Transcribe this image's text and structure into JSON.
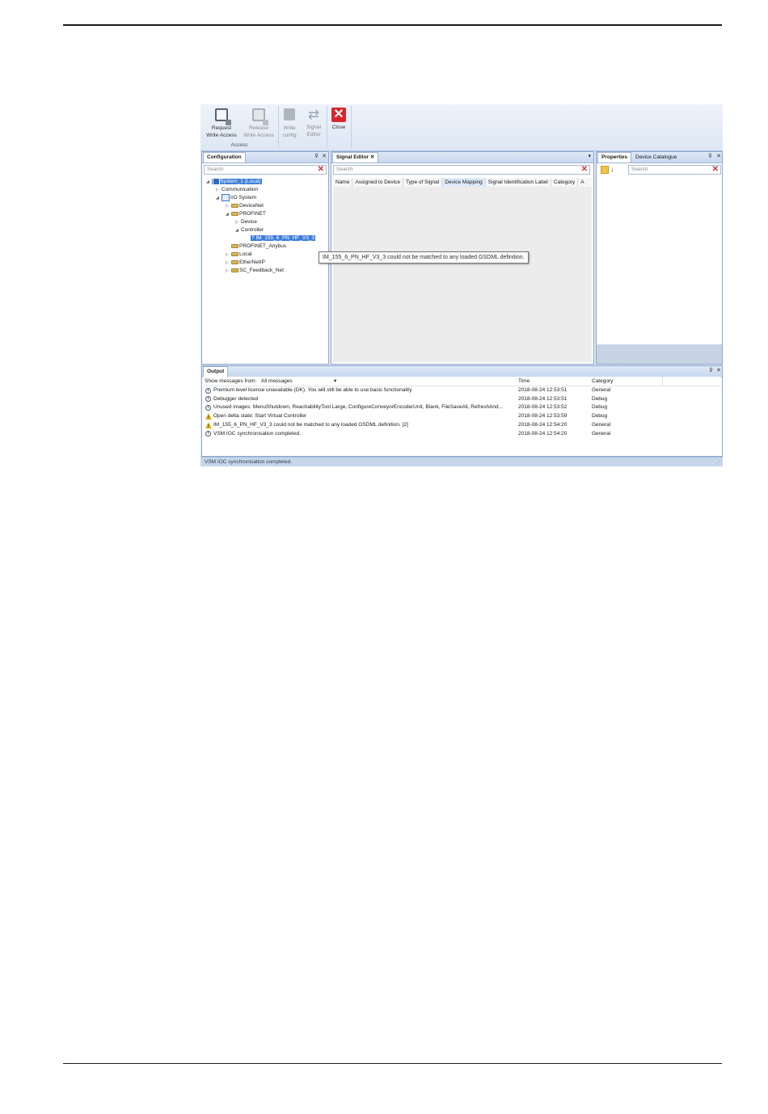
{
  "ribbon": {
    "buttons": [
      {
        "label_line1": "Request",
        "label_line2": "Write Access",
        "icon": "device-lock-icon",
        "enabled": true
      },
      {
        "label_line1": "Release",
        "label_line2": "Write Access",
        "icon": "device-unlock-icon",
        "enabled": false
      },
      {
        "label_line1": "Write",
        "label_line2": "config",
        "icon": "write-config-icon",
        "enabled": false
      },
      {
        "label_line1": "Signal",
        "label_line2": "Editor",
        "icon": "swap-arrows-icon",
        "enabled": false
      },
      {
        "label_line1": "Close",
        "label_line2": "",
        "icon": "close-icon",
        "enabled": true
      }
    ],
    "group_label": "Access"
  },
  "configuration": {
    "tab": "Configuration",
    "search_placeholder": "Search",
    "tree": [
      {
        "label": "System_1 (Local)",
        "toggle": "◢"
      },
      {
        "label": "Communication",
        "toggle": "▷"
      },
      {
        "label": "I/O System",
        "toggle": "◢"
      },
      {
        "label": "DeviceNet",
        "toggle": "▷"
      },
      {
        "label": "PROFINET",
        "toggle": "◢"
      },
      {
        "label": "Device",
        "toggle": "▷"
      },
      {
        "label": "Controller",
        "toggle": "◢"
      },
      {
        "label": "IM_155_6_PN_HF_V3_3",
        "toggle": ""
      },
      {
        "label": "PROFINET_Anybus",
        "toggle": ""
      },
      {
        "label": "Local",
        "toggle": "▷"
      },
      {
        "label": "EtherNetIP",
        "toggle": "▷"
      },
      {
        "label": "SC_Feedback_Net",
        "toggle": "▷"
      }
    ]
  },
  "signal_editor": {
    "tab": "Signal Editor",
    "search_placeholder": "Search",
    "columns": [
      "Name",
      "Assigned to Device",
      "Type of Signal",
      "Device Mapping",
      "Signal Identification Label",
      "Category",
      "A"
    ]
  },
  "properties": {
    "tabs": [
      "Properties",
      "Device Catalogue"
    ],
    "search_placeholder": "Search"
  },
  "tooltip": "IM_155_6_PN_HF_V3_3 could not be matched to any loaded GSDML definition.",
  "output": {
    "tab": "Output",
    "show_from_label": "Show messages from:",
    "show_from_value": "All messages",
    "columns": {
      "time": "Time",
      "category": "Category"
    },
    "rows": [
      {
        "type": "info",
        "message": "Premium level license unavailable (DK). You will still be able to use basic functionality.",
        "time": "2018-08-24 12:53:51",
        "category": "General"
      },
      {
        "type": "info",
        "message": "Debugger detected",
        "time": "2018-08-24 12:53:51",
        "category": "Debug"
      },
      {
        "type": "info",
        "message": "Unused images: MenuShutdown, ReachabilityTool Large, ConfigureConveyorEncoderUnit, Blank, FileSaveAll, RefreshAnd...",
        "time": "2018-08-24 12:53:52",
        "category": "Debug"
      },
      {
        "type": "warning",
        "message": "Open delta state: Start Virtual Controller",
        "time": "2018-08-24 12:53:59",
        "category": "Debug"
      },
      {
        "type": "warning",
        "message": "IM_155_6_PN_HF_V3_3 could not be matched to any loaded GSDML definition. [2]",
        "time": "2018-08-24 12:54:20",
        "category": "General"
      },
      {
        "type": "info",
        "message": "VSM IOC synchronisation completed.",
        "time": "2018-08-24 12:54:20",
        "category": "General"
      }
    ]
  },
  "statusbar": "VSM IOC synchronisation completed."
}
